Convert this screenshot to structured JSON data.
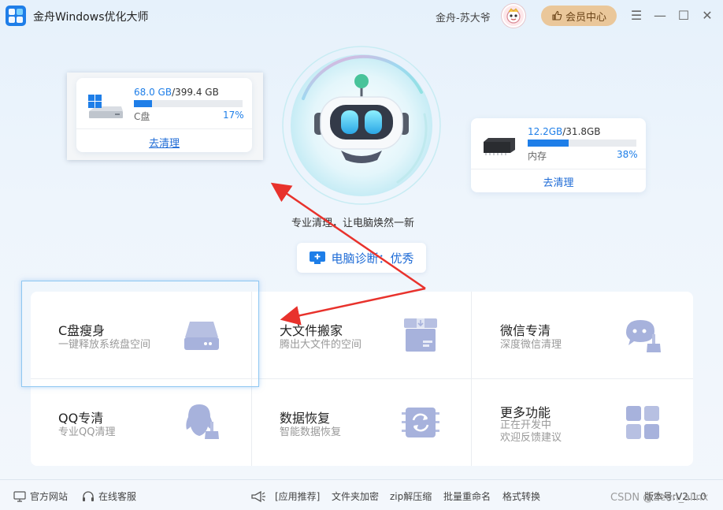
{
  "app": {
    "title": "金舟Windows优化大师"
  },
  "user": {
    "name": "金舟-苏大爷",
    "vip_label": "会员中心"
  },
  "window_controls": {
    "menu": "☰",
    "minimize": "—",
    "maximize": "☐",
    "close": "✕"
  },
  "disk_c": {
    "used": "68.0 GB",
    "total": "/399.4 GB",
    "label": "C盘",
    "percent_text": "17%",
    "percent": 17,
    "action": "去清理"
  },
  "memory": {
    "used": "12.2GB",
    "total": "/31.8GB",
    "label": "内存",
    "percent_text": "38%",
    "percent": 38,
    "action": "去清理"
  },
  "hero": {
    "tagline": "专业清理，让电脑焕然一新",
    "diagnosis": "电脑诊断：优秀"
  },
  "features": [
    {
      "title": "C盘瘦身",
      "subtitle": "一键释放系统盘空间",
      "icon": "disk-icon"
    },
    {
      "title": "大文件搬家",
      "subtitle": "腾出大文件的空间",
      "icon": "box-icon"
    },
    {
      "title": "微信专清",
      "subtitle": "深度微信清理",
      "icon": "wechat-brush-icon"
    },
    {
      "title": "QQ专清",
      "subtitle": "专业QQ清理",
      "icon": "qq-brush-icon"
    },
    {
      "title": "数据恢复",
      "subtitle": "智能数据恢复",
      "icon": "recovery-icon"
    },
    {
      "title": "更多功能",
      "subtitle": "正在开发中",
      "subtitle2": "欢迎反馈建议",
      "icon": "grid-icon"
    }
  ],
  "footer": {
    "website": "官方网站",
    "support": "在线客服",
    "recommend": "[应用推荐]",
    "links": [
      "文件夹加密",
      "zip解压缩",
      "批量重命名",
      "格式转换"
    ],
    "version": "版本号:V2.1.0",
    "watermark": "CSDN @Sean_alinx"
  },
  "colors": {
    "accent": "#1e7ee8",
    "vip": "#eac79a",
    "icon": "#aab5db",
    "arrow": "#e8322c"
  }
}
